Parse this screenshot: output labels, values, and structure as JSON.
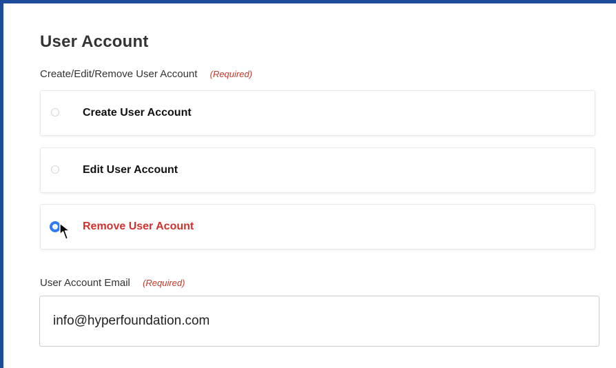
{
  "form": {
    "title": "User Account",
    "action_field": {
      "label": "Create/Edit/Remove User Account",
      "required": "(Required)",
      "options": [
        {
          "label": "Create User Account",
          "selected": false
        },
        {
          "label": "Edit User Account",
          "selected": false
        },
        {
          "label": "Remove User Acount",
          "selected": true
        }
      ]
    },
    "email_field": {
      "label": "User Account Email",
      "required": "(Required)",
      "value": "info@hyperfoundation.com"
    }
  },
  "colors": {
    "frame_border": "#1e4a9a",
    "radio_selected": "#2b7cf6",
    "selected_label": "#d0312d",
    "required_text": "#c0392b"
  },
  "icons": {
    "cursor": "mouse-pointer-arrow-icon"
  }
}
